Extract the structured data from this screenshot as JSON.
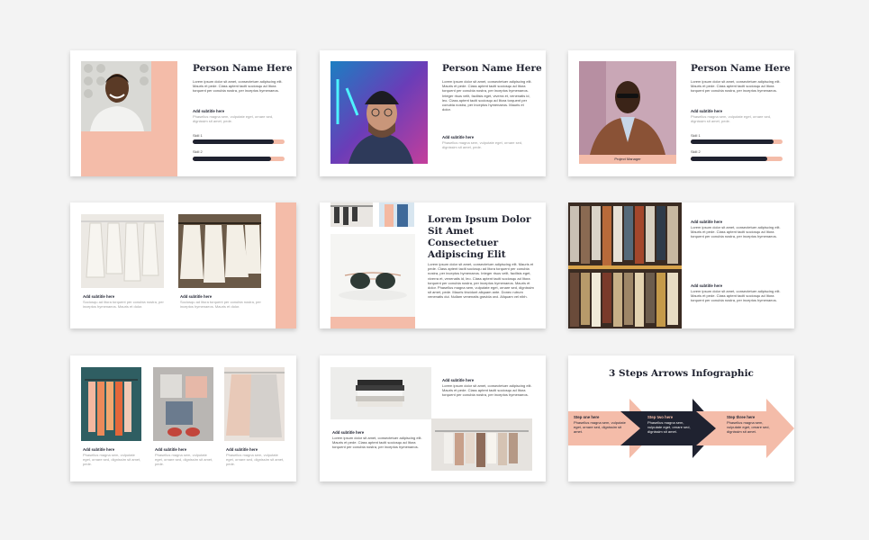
{
  "colors": {
    "accent": "#f4bca9",
    "dark": "#1f2230",
    "background": "#f3f3f3"
  },
  "s1": {
    "name": "Person Name Here",
    "body": "Lorem ipsum dolor sit amet, consectetuer adipiscing elit. Mauris et pede. Class aptent taciti sociosqu ad litora torquent per conubia nostra, per inceptos hymenaeos.",
    "subtitle": "Add subtitle here",
    "subtext": "Phasellus magna sem, vulputate eget, ornare sed, dignissim sit amet, pede.",
    "skill1": "Skill 1",
    "skill2": "Skill 2",
    "skill1_level": 0.88,
    "skill2_level": 0.85
  },
  "s2": {
    "name": "Person Name Here",
    "body": "Lorem ipsum dolor sit amet, consectetuer adipiscing elit. Mauris et pede. Class aptent taciti sociosqu ad litora torquent per conubia nostra, per inceptos hymenaeos. Integer risus velit, facilisis eget, viverra et, venenatis id, leo. Class aptent taciti sociosqu ad litora torquent per conubia nostra, per inceptos hymenaeos. Mauris et dolor.",
    "subtitle": "Add subtitle here",
    "subtext": "Phasellus magna sem, vulputate eget, ornare sed, dignissim sit amet, pede."
  },
  "s3": {
    "name": "Person Name Here",
    "body": "Lorem ipsum dolor sit amet, consectetuer adipiscing elit. Mauris et pede. Class aptent taciti sociosqu ad litora torquent per conubia nostra, per inceptos hymenaeos.",
    "subtitle": "Add subtitle here",
    "subtext": "Phasellus magna sem, vulputate eget, ornare sed, dignissim sit amet, pede.",
    "caption": "Project Manager",
    "skill1": "Skill 1",
    "skill2": "Skill 2",
    "skill1_level": 0.9,
    "skill2_level": 0.83
  },
  "s4": {
    "items": [
      {
        "subtitle": "Add subtitle here",
        "text": "Sociosqu ad litora torquent per conubia nostra, per inceptos hymenaeos. Mauris et dolor."
      },
      {
        "subtitle": "Add subtitle here",
        "text": "Sociosqu ad litora torquent per conubia nostra, per inceptos hymenaeos. Mauris et dolor."
      }
    ]
  },
  "s5": {
    "title": "Lorem Ipsum Dolor Sit Amet Consectetuer Adipiscing Elit",
    "body": "Lorem ipsum dolor sit amet, consectetuer adipiscing elit. Mauris et pede. Class aptent taciti sociosqu ad litora torquent per conubia nostra, per inceptos hymenaeos. Integer risus velit, facilisis eget, viverra et, venenatis id, leo. Class aptent taciti sociosqu ad litora torquent per conubia nostra, per inceptos hymenaeos. Mauris et dolor. Phasellus magna sem, vulputate eget, ornare sed, dignissim sit amet, pede. Mauris tincidunt aliquam ante. Donec rutrum venenatis dui. Nullam venenatis gravida orci. Aliquam vel nibh."
  },
  "s6": {
    "items": [
      {
        "subtitle": "Add subtitle here",
        "text": "Lorem ipsum dolor sit amet, consectetuer adipiscing elit. Mauris et pede. Class aptent taciti sociosqu ad litora torquent per conubia nostra, per inceptos hymenaeos."
      },
      {
        "subtitle": "Add subtitle here",
        "text": "Lorem ipsum dolor sit amet, consectetuer adipiscing elit. Mauris et pede. Class aptent taciti sociosqu ad litora torquent per conubia nostra, per inceptos hymenaeos."
      }
    ]
  },
  "s7": {
    "items": [
      {
        "subtitle": "Add subtitle here",
        "text": "Phasellus magna sem, vulputate eget, ornare sed, dignissim sit amet, pede."
      },
      {
        "subtitle": "Add subtitle here",
        "text": "Phasellus magna sem, vulputate eget, ornare sed, dignissim sit amet, pede."
      },
      {
        "subtitle": "Add subtitle here",
        "text": "Phasellus magna sem, vulputate eget, ornare sed, dignissim sit amet, pede."
      }
    ]
  },
  "s8": {
    "items": [
      {
        "subtitle": "Add subtitle here",
        "text": "Lorem ipsum dolor sit amet, consectetuer adipiscing elit. Mauris et pede. Class aptent taciti sociosqu ad litora torquent per conubia nostra, per inceptos hymenaeos."
      },
      {
        "subtitle": "Add subtitle here",
        "text": "Lorem ipsum dolor sit amet, consectetuer adipiscing elit. Mauris et pede. Class aptent taciti sociosqu ad litora torquent per conubia nostra, per inceptos hymenaeos."
      }
    ]
  },
  "s9": {
    "title": "3 Steps Arrows Infographic",
    "steps": [
      {
        "title": "Step one here",
        "text": "Phasellus magna sem, vulputate eget, ornare sed, dignissim sit amet."
      },
      {
        "title": "Step two here",
        "text": "Phasellus magna sem, vulputate eget, ornare sed, dignissim sit amet."
      },
      {
        "title": "Step three here",
        "text": "Phasellus magna sem, vulputate eget, ornare sed, dignissim sit amet."
      }
    ]
  }
}
